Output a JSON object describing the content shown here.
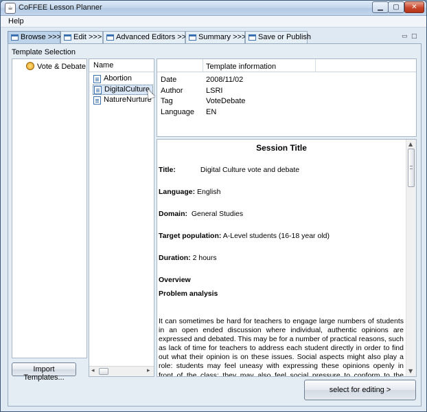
{
  "window": {
    "title": "CoFFEE Lesson Planner"
  },
  "menu": {
    "help": "Help"
  },
  "tabs": [
    {
      "label": "Browse >>>",
      "active": true
    },
    {
      "label": "Edit >>>",
      "active": false
    },
    {
      "label": "Advanced Editors >>>",
      "active": false
    },
    {
      "label": "Summary >>>",
      "active": false
    },
    {
      "label": "Save or Publish",
      "active": false
    }
  ],
  "template_selection": {
    "label": "Template Selection",
    "tree_item": "Vote & Debate",
    "import_button": "Import Templates..."
  },
  "file_list": {
    "header": "Name",
    "items": [
      "Abortion",
      "DigitalCulture",
      "NatureNurture"
    ],
    "selected": "DigitalCulture"
  },
  "template_info": {
    "header": "Template information",
    "rows": [
      {
        "label": "Date",
        "value": "2008/11/02"
      },
      {
        "label": "Author",
        "value": "LSRI"
      },
      {
        "label": "Tag",
        "value": "VoteDebate"
      },
      {
        "label": "Language",
        "value": "EN"
      }
    ]
  },
  "session": {
    "heading": "Session Title",
    "title_label": "Title:",
    "title_value": "Digital Culture vote and debate",
    "language_label": "Language:",
    "language_value": "English",
    "domain_label": "Domain:",
    "domain_value": "General Studies",
    "target_label": "Target population:",
    "target_value": "A-Level students (16-18 year old)",
    "duration_label": "Duration:",
    "duration_value": "2 hours",
    "overview": "Overview",
    "problem_analysis": "Problem analysis",
    "paragraph": "It can sometimes be hard for teachers to engage large numbers of students in an open ended discussion where individual, authentic opinions are expressed and debated. This may be for a number of practical reasons, such as lack of time for teachers to address each student directly in order to find out what their opinion is on these issues. Social aspects might also play a role: students may feel uneasy with expressing these opinions openly in front of the class; they may also feel social pressure to conform to the positions expressed by"
  },
  "actions": {
    "select_button": "select for editing >"
  }
}
